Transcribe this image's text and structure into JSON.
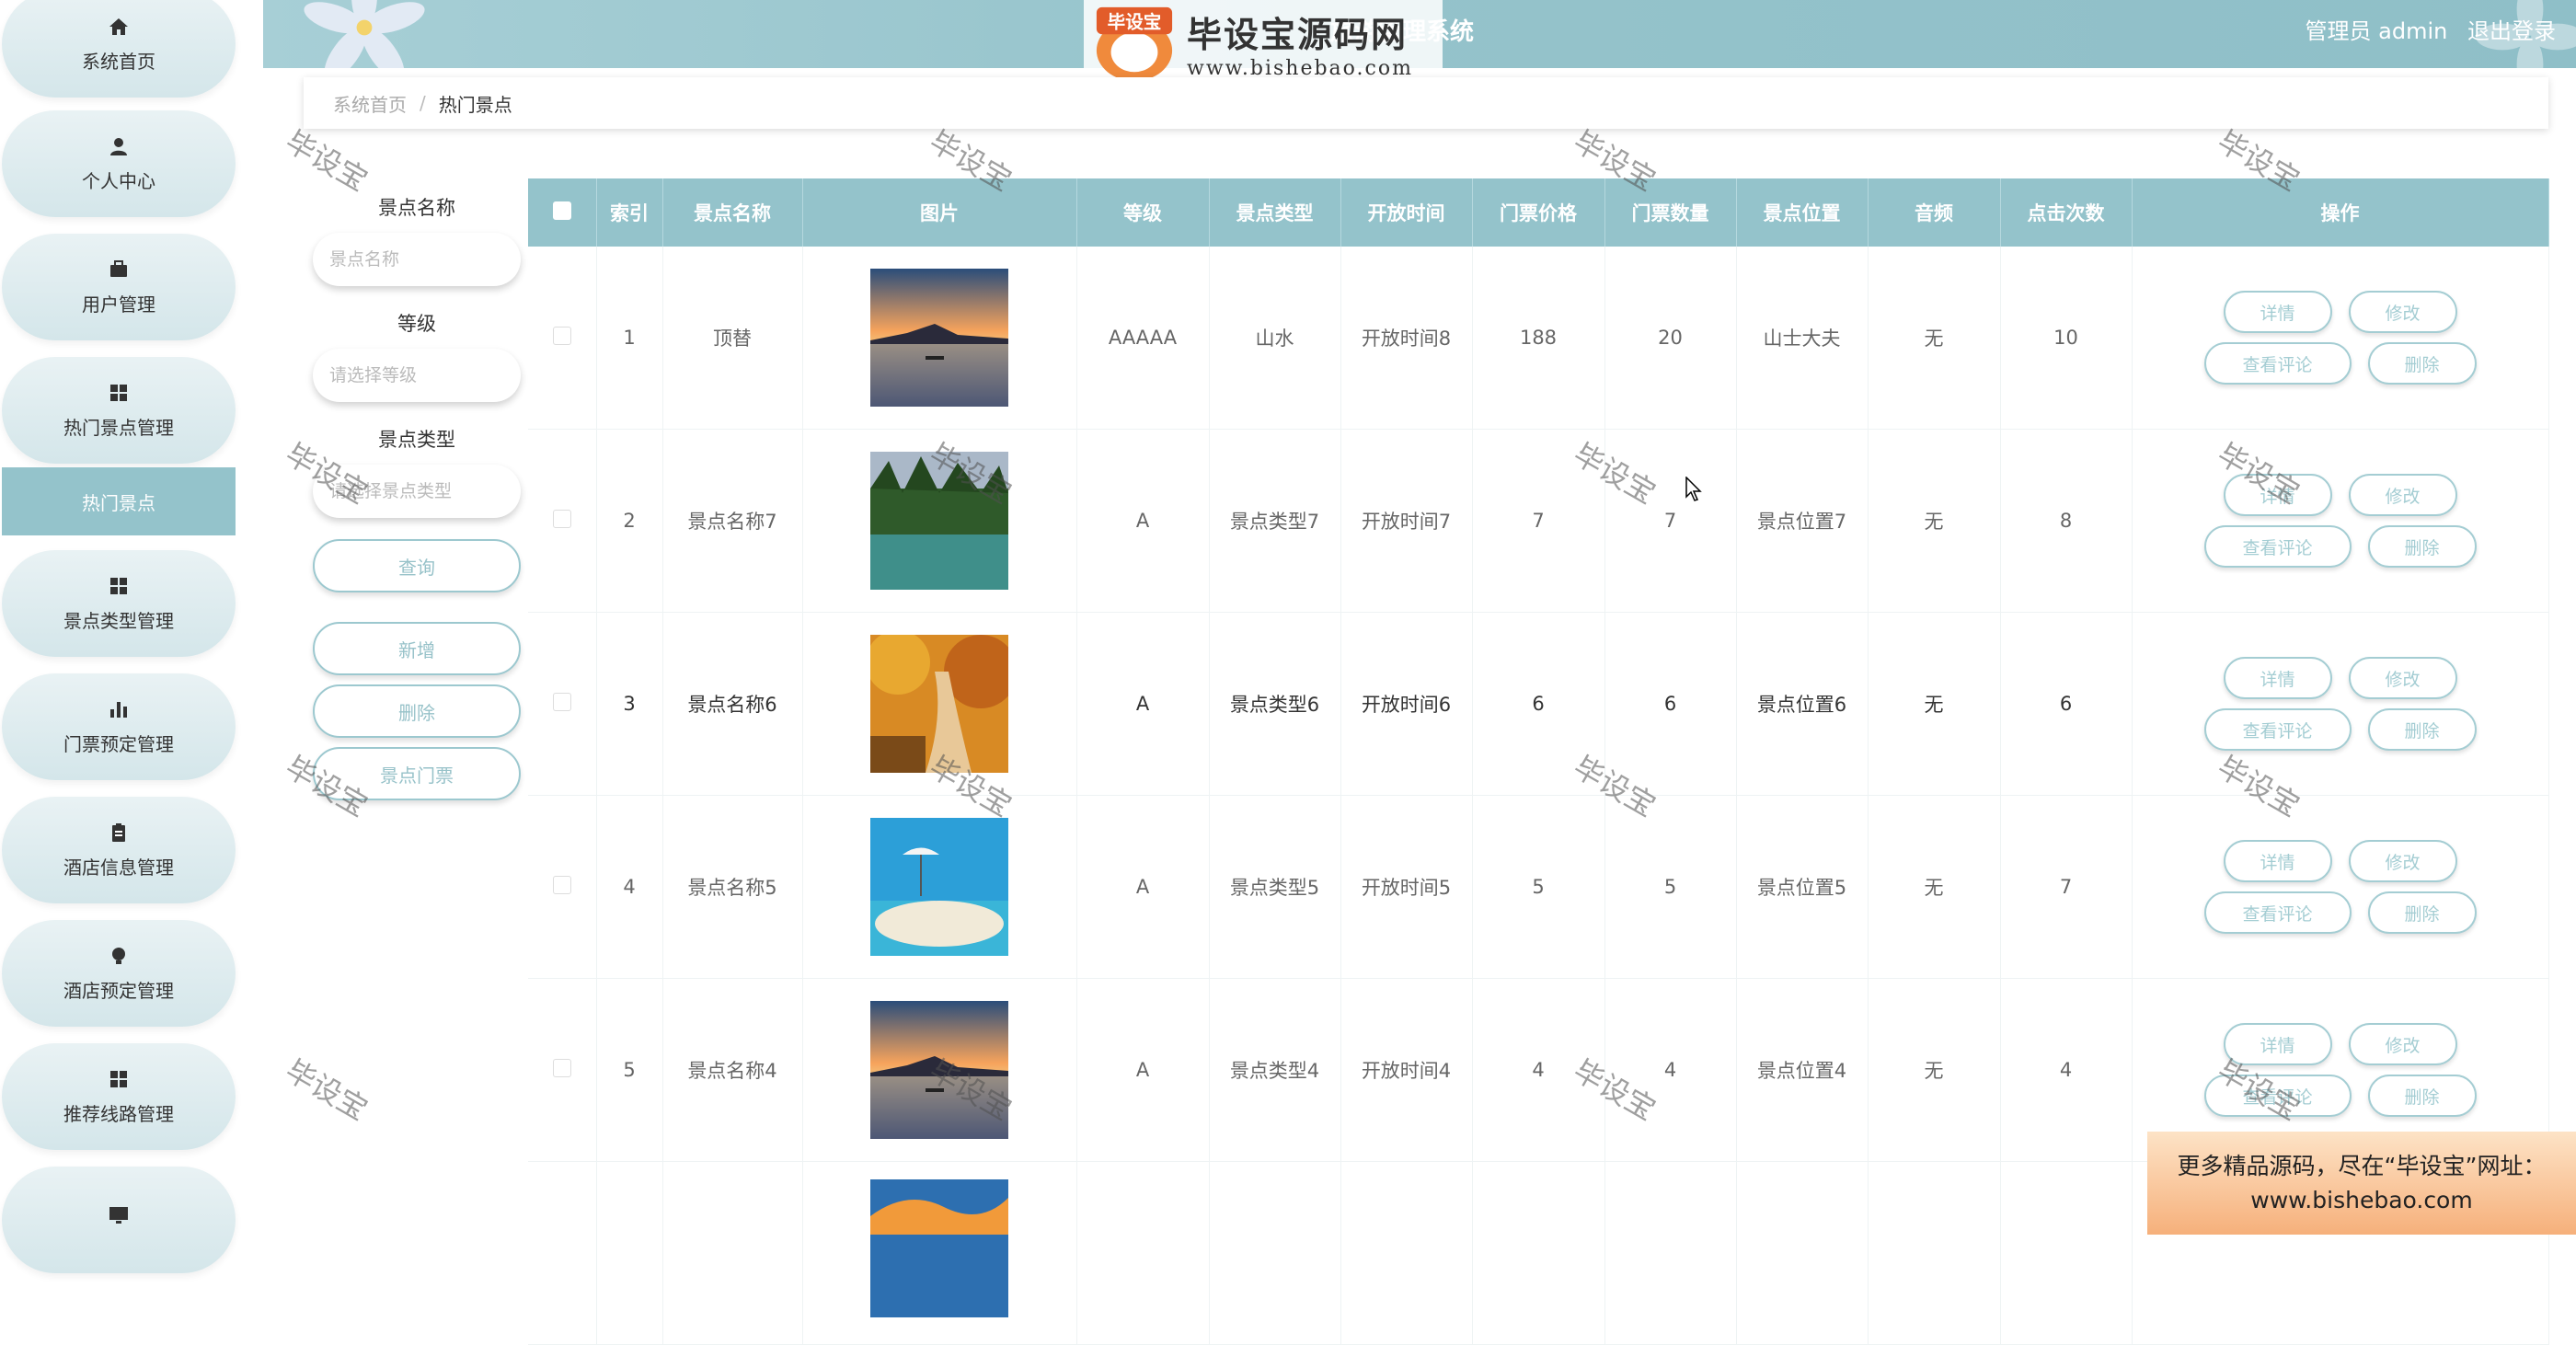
{
  "header": {
    "system_title": "旅游管理系统",
    "user_label": "管理员 admin",
    "logout_label": "退出登录"
  },
  "watermark": {
    "logo_badge": "毕设宝",
    "logo_big": "毕设宝源码网",
    "logo_url": "www.bishebao.com",
    "diagonal_text": "毕设宝",
    "promo_line1": "更多精品源码，尽在“毕设宝”网址：",
    "promo_line2": "www.bishebao.com"
  },
  "sidebar": {
    "items": [
      {
        "label": "系统首页",
        "icon": "home-icon"
      },
      {
        "label": "个人中心",
        "icon": "user-icon"
      },
      {
        "label": "用户管理",
        "icon": "briefcase-icon"
      },
      {
        "label": "热门景点管理",
        "icon": "grid-icon"
      },
      {
        "label": "景点类型管理",
        "icon": "grid-icon"
      },
      {
        "label": "门票预定管理",
        "icon": "bar-chart-icon"
      },
      {
        "label": "酒店信息管理",
        "icon": "clipboard-icon"
      },
      {
        "label": "酒店预定管理",
        "icon": "bulb-icon"
      },
      {
        "label": "推荐线路管理",
        "icon": "grid-icon"
      }
    ],
    "sub_item": "热门景点"
  },
  "breadcrumb": {
    "home": "系统首页",
    "separator": "/",
    "current": "热门景点"
  },
  "search": {
    "name_label": "景点名称",
    "name_placeholder": "景点名称",
    "level_label": "等级",
    "level_placeholder": "请选择等级",
    "type_label": "景点类型",
    "type_placeholder": "请选择景点类型",
    "query_button": "查询",
    "add_button": "新增",
    "delete_button": "删除",
    "ticket_button": "景点门票"
  },
  "table": {
    "headers": [
      "索引",
      "景点名称",
      "图片",
      "等级",
      "景点类型",
      "开放时间",
      "门票价格",
      "门票数量",
      "景点位置",
      "音频",
      "点击次数",
      "操作"
    ],
    "rows": [
      {
        "index": "1",
        "name": "顶替",
        "level": "AAAAA",
        "type": "山水",
        "open_time": "开放时间8",
        "price": "188",
        "qty": "20",
        "location": "山士大夫",
        "audio": "无",
        "clicks": "10",
        "image": "sunset-lake"
      },
      {
        "index": "2",
        "name": "景点名称7",
        "level": "A",
        "type": "景点类型7",
        "open_time": "开放时间7",
        "price": "7",
        "qty": "7",
        "location": "景点位置7",
        "audio": "无",
        "clicks": "8",
        "image": "forest-river"
      },
      {
        "index": "3",
        "name": "景点名称6",
        "level": "A",
        "type": "景点类型6",
        "open_time": "开放时间6",
        "price": "6",
        "qty": "6",
        "location": "景点位置6",
        "audio": "无",
        "clicks": "6",
        "image": "autumn-path"
      },
      {
        "index": "4",
        "name": "景点名称5",
        "level": "A",
        "type": "景点类型5",
        "open_time": "开放时间5",
        "price": "5",
        "qty": "5",
        "location": "景点位置5",
        "audio": "无",
        "clicks": "7",
        "image": "beach"
      },
      {
        "index": "5",
        "name": "景点名称4",
        "level": "A",
        "type": "景点类型4",
        "open_time": "开放时间4",
        "price": "4",
        "qty": "4",
        "location": "景点位置4",
        "audio": "无",
        "clicks": "4",
        "image": "sunset-lake"
      }
    ],
    "actions": {
      "detail": "详情",
      "edit": "修改",
      "comments": "查看评论",
      "delete": "删除"
    }
  },
  "colors": {
    "accent": "#94c3cb",
    "header": "#95c3cb"
  }
}
